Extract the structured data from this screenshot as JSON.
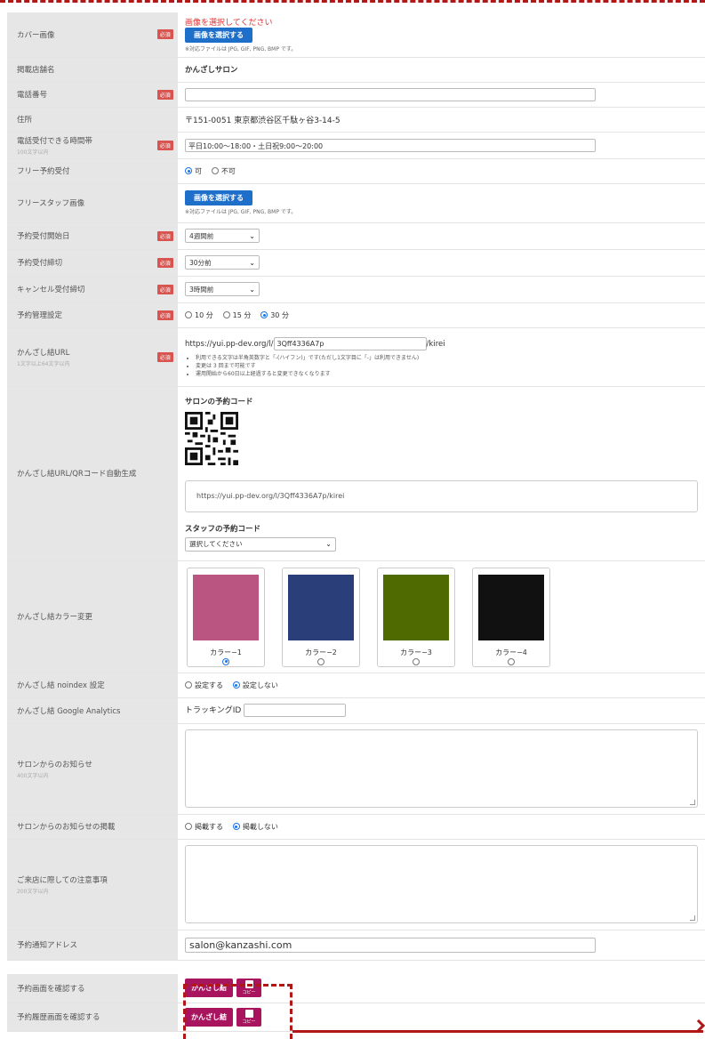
{
  "required_badge": "必須",
  "choose_image_button": "画像を選択する",
  "file_types_note": "※対応ファイルは JPG, GIF, PNG, BMP です。",
  "rows": {
    "cover": {
      "label": "カバー画像",
      "error": "画像を選択してください"
    },
    "shop_name": {
      "label": "掲載店舗名",
      "value": "かんざしサロン"
    },
    "phone": {
      "label": "電話番号",
      "value": ""
    },
    "address": {
      "label": "住所",
      "value": "〒151-0051 東京都渋谷区千駄ヶ谷3-14-5"
    },
    "phone_hours": {
      "label": "電話受付できる時間帯",
      "sublabel": "100文字以内",
      "value": "平日10:00～18:00・土日祝9:00～20:00"
    },
    "free_reservation": {
      "label": "フリー予約受付",
      "options": [
        "可",
        "不可"
      ],
      "selected": "可"
    },
    "free_staff_image": {
      "label": "フリースタッフ画像"
    },
    "booking_start": {
      "label": "予約受付開始日",
      "selected": "4週間前"
    },
    "booking_deadline": {
      "label": "予約受付締切",
      "selected": "30分前"
    },
    "cancel_deadline": {
      "label": "キャンセル受付締切",
      "selected": "3時間前"
    },
    "booking_slot": {
      "label": "予約管理設定",
      "options": [
        "10 分",
        "15 分",
        "30 分"
      ],
      "selected": "30 分"
    },
    "kanzashi_url": {
      "label": "かんざし結URL",
      "sublabel": "1文字以上64文字以内",
      "prefix": "https://yui.pp-dev.org/l/",
      "value": "3Qff4336A7p",
      "suffix": "/kirei",
      "notes": [
        "利用できる文字は半角英数字と「-(ハイフン)」です(ただし1文字目に「-」は利用できません)",
        "変更は 3 回まで可能です",
        "運用開始から60日以上経過すると変更できなくなります"
      ]
    },
    "qr": {
      "label": "かんざし結URL/QRコード自動生成",
      "salon_code_title": "サロンの予約コード",
      "url": "https://yui.pp-dev.org/l/3Qff4336A7p/kirei",
      "staff_code_title": "スタッフの予約コード",
      "staff_select": "選択してください"
    },
    "color": {
      "label": "かんざし結カラー変更",
      "options": [
        {
          "label": "カラー−1",
          "color": "#b95580",
          "selected": true
        },
        {
          "label": "カラー−2",
          "color": "#2a3e7a",
          "selected": false
        },
        {
          "label": "カラー−3",
          "color": "#4f6a00",
          "selected": false
        },
        {
          "label": "カラー−4",
          "color": "#111111",
          "selected": false
        }
      ]
    },
    "noindex": {
      "label": "かんざし結 noindex 設定",
      "options": [
        "設定する",
        "設定しない"
      ],
      "selected": "設定しない"
    },
    "analytics": {
      "label": "かんざし結 Google Analytics",
      "field_label": "トラッキングID",
      "value": ""
    },
    "notice": {
      "label": "サロンからのお知らせ",
      "sublabel": "400文字以内"
    },
    "notice_publish": {
      "label": "サロンからのお知らせの掲載",
      "options": [
        "掲載する",
        "掲載しない"
      ],
      "selected": "掲載しない"
    },
    "visit_notes": {
      "label": "ご来店に際しての注意事項",
      "sublabel": "200文字以内"
    },
    "notify_address": {
      "label": "予約通知アドレス",
      "value": "salon@kanzashi.com"
    }
  },
  "confirm": {
    "booking_screen": {
      "label": "予約画面を確認する"
    },
    "history_screen": {
      "label": "予約履歴画面を確認する"
    },
    "kanzashi_button": "かんざし結",
    "copy_button": "コピー"
  },
  "colors": {
    "accent_blue": "#1e6fc9",
    "required_red": "#d9534f",
    "brand_pink": "#a8155e",
    "annotation_red": "#b01717"
  }
}
